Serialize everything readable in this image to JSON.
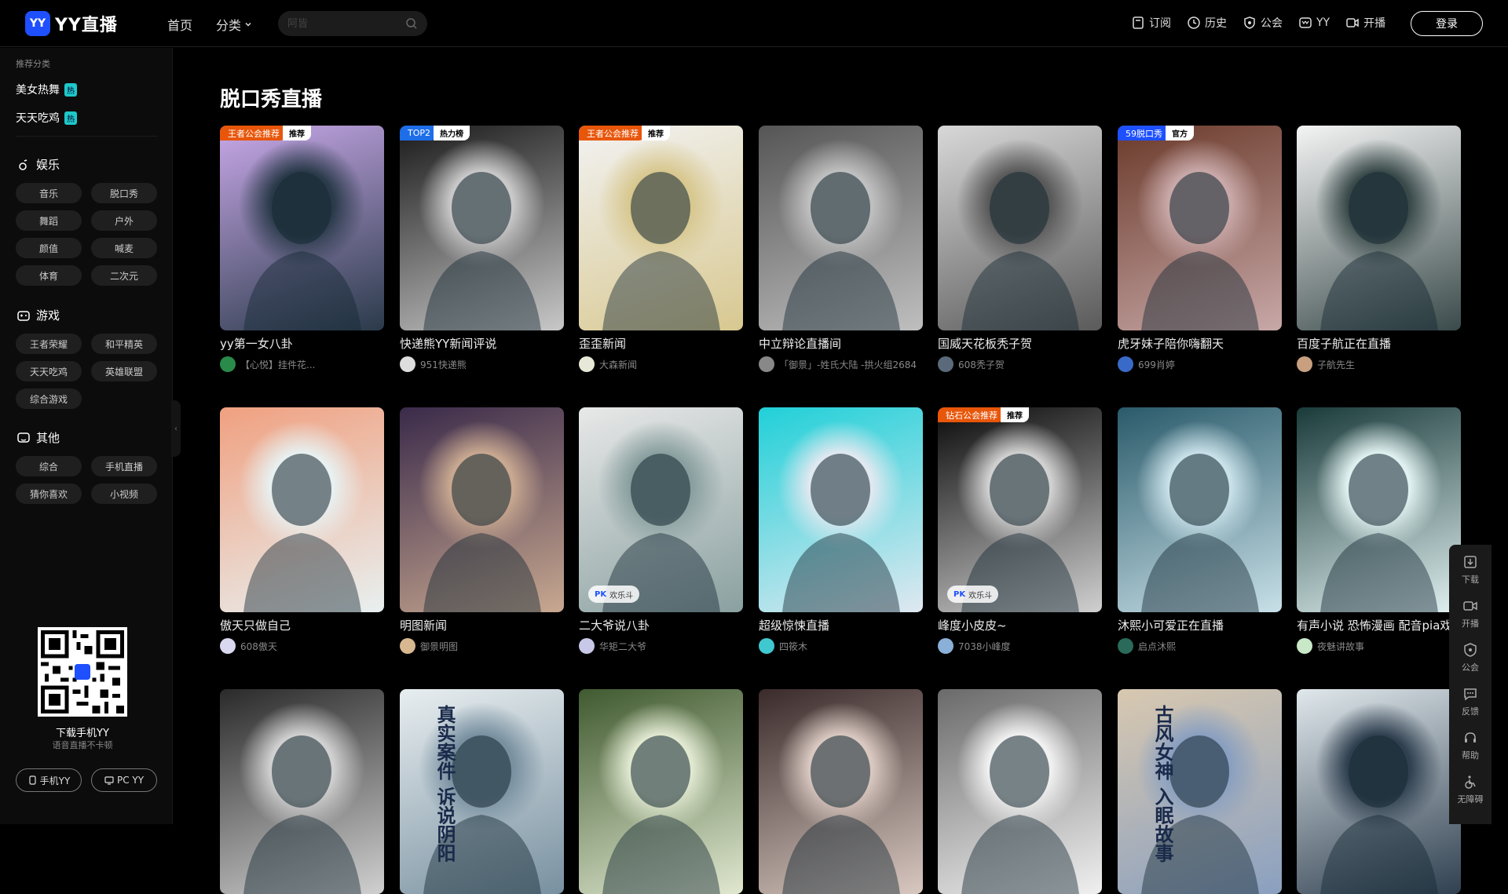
{
  "header": {
    "logo_badge": "YY",
    "logo_text": "YY直播",
    "nav": [
      "首页",
      "分类"
    ],
    "search_placeholder": "阿皆",
    "right_nav": [
      "订阅",
      "历史",
      "公会",
      "YY",
      "开播"
    ],
    "login": "登录"
  },
  "sidebar": {
    "rec_title": "推荐分类",
    "rec_items": [
      {
        "label": "美女热舞",
        "badge": "热"
      },
      {
        "label": "天天吃鸡",
        "badge": "热"
      }
    ],
    "sections": [
      {
        "title": "娱乐",
        "tags": [
          "音乐",
          "脱口秀",
          "舞蹈",
          "户外",
          "颜值",
          "喊麦",
          "体育",
          "二次元"
        ]
      },
      {
        "title": "游戏",
        "tags": [
          "王者荣耀",
          "和平精英",
          "天天吃鸡",
          "英雄联盟",
          "综合游戏"
        ]
      },
      {
        "title": "其他",
        "tags": [
          "综合",
          "手机直播",
          "猜你喜欢",
          "小视频"
        ]
      }
    ],
    "download_title": "下载手机YY",
    "download_sub": "语音直播不卡顿",
    "btn_mobile": "手机YY",
    "btn_pc": "PC YY"
  },
  "main": {
    "title": "脱口秀直播",
    "cards": [
      {
        "title": "yy第一女八卦",
        "anchor": "【心悦】挂件花...",
        "badge1": "王者公会推荐",
        "badge2": "推荐",
        "badge_color": "#e8560a",
        "c1": "#c8a8e8",
        "c2": "#2a3a4a",
        "av": "#2a8a4a"
      },
      {
        "title": "快递熊YY新闻评说",
        "anchor": "951快递熊",
        "badge1": "TOP2",
        "badge2": "热力榜",
        "badge_color": "#1e6ee8",
        "c1": "#1a1a1a",
        "c2": "#c8c8c8",
        "av": "#dddddd"
      },
      {
        "title": "歪歪新闻",
        "anchor": "大森新闻",
        "badge1": "王者公会推荐",
        "badge2": "推荐",
        "badge_color": "#e8560a",
        "c1": "#f2f2f2",
        "c2": "#d8c890",
        "av": "#e8e8d8"
      },
      {
        "title": "中立辩论直播间",
        "anchor": "「御景」-姓氏大陆 -拱火组2684",
        "badge1": "",
        "badge2": "",
        "badge_color": "",
        "c1": "#555555",
        "c2": "#bfbfbf",
        "av": "#888888"
      },
      {
        "title": "国威天花板秃子贺",
        "anchor": "608秃子贺",
        "badge1": "",
        "badge2": "",
        "badge_color": "",
        "c1": "#d8d8d8",
        "c2": "#5a5a5a",
        "av": "#5a6a7a"
      },
      {
        "title": "虎牙妹子陪你嗨翻天",
        "anchor": "699肖婷",
        "badge1": "59脱口秀",
        "badge2": "官方",
        "badge_color": "#1e50ff",
        "c1": "#6a3a2a",
        "c2": "#c8a8a8",
        "av": "#3a6ac8"
      },
      {
        "title": "百度子航正在直播",
        "anchor": "子航先生",
        "badge1": "",
        "badge2": "",
        "badge_color": "",
        "c1": "#f4f4f4",
        "c2": "#3a4a4a",
        "av": "#c8a080"
      },
      {
        "title": "傲天只做自己",
        "anchor": "608傲天",
        "badge1": "",
        "badge2": "",
        "badge_color": "",
        "c1": "#f0a080",
        "c2": "#e8f0f0",
        "av": "#d8d8f0"
      },
      {
        "title": "明图新闻",
        "anchor": "御景明图",
        "badge1": "",
        "badge2": "",
        "badge_color": "",
        "c1": "#3a2a4a",
        "c2": "#c8a890",
        "av": "#d8b890"
      },
      {
        "title": "二大爷说八卦",
        "anchor": "华矩二大爷",
        "badge1": "",
        "badge2": "",
        "badge_color": "",
        "pk": "欢乐斗",
        "c1": "#e8e8e8",
        "c2": "#8aa0a0",
        "av": "#c8c8e8"
      },
      {
        "title": "超级惊悚直播",
        "anchor": "四筱木",
        "badge1": "",
        "badge2": "",
        "badge_color": "",
        "c1": "#20d0d8",
        "c2": "#e0e8f0",
        "av": "#40c8d0"
      },
      {
        "title": "峰度小皮皮~",
        "anchor": "7038小峰度",
        "badge1": "钻石公会推荐",
        "badge2": "推荐",
        "badge_color": "#e8560a",
        "pk": "欢乐斗",
        "c1": "#0a0a0a",
        "c2": "#d0d0d0",
        "av": "#8ab0d8"
      },
      {
        "title": "沐熙小可爱正在直播",
        "anchor": "启点沐熙",
        "badge1": "",
        "badge2": "",
        "badge_color": "",
        "c1": "#2a5a6a",
        "c2": "#c8e0e8",
        "av": "#2a6a5a"
      },
      {
        "title": "有声小说 恐怖漫画 配音pia戏",
        "anchor": "夜魅讲故事",
        "badge1": "",
        "badge2": "",
        "badge_color": "",
        "c1": "#1a3a3a",
        "c2": "#e0f0f0",
        "av": "#c8e8c8"
      },
      {
        "title": "",
        "anchor": "",
        "badge1": "",
        "badge2": "",
        "badge_color": "",
        "c1": "#2a2a2a",
        "c2": "#d0d0d0",
        "av": "#888888"
      },
      {
        "title": "",
        "anchor": "",
        "badge1": "",
        "badge2": "",
        "badge_color": "",
        "c1": "#e8eef0",
        "c2": "#7890a0",
        "av": "#888888",
        "poster": "真实案件 诉说阴阳"
      },
      {
        "title": "",
        "anchor": "",
        "badge1": "",
        "badge2": "",
        "badge_color": "",
        "c1": "#405a30",
        "c2": "#e0e8d0",
        "av": "#888888"
      },
      {
        "title": "",
        "anchor": "",
        "badge1": "",
        "badge2": "",
        "badge_color": "",
        "c1": "#3a2a2a",
        "c2": "#d8c8c0",
        "av": "#888888"
      },
      {
        "title": "",
        "anchor": "",
        "badge1": "",
        "badge2": "",
        "badge_color": "",
        "c1": "#6a6a6a",
        "c2": "#f0f0f0",
        "av": "#888888"
      },
      {
        "title": "",
        "anchor": "",
        "badge1": "",
        "badge2": "",
        "badge_color": "",
        "c1": "#d8c8b0",
        "c2": "#8aa0c0",
        "av": "#888888",
        "poster": "古风女神 入眠故事"
      },
      {
        "title": "",
        "anchor": "",
        "badge1": "",
        "badge2": "",
        "badge_color": "",
        "c1": "#e0e8ec",
        "c2": "#304050",
        "av": "#888888"
      }
    ]
  },
  "toolbar": [
    "下载",
    "开播",
    "公会",
    "反馈",
    "帮助",
    "无障碍"
  ]
}
